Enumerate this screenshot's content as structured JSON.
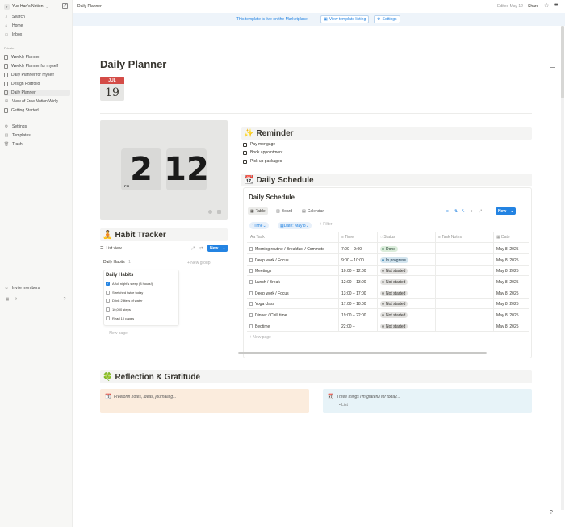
{
  "sidebar": {
    "workspace_initial": "Y",
    "workspace_name": "Yue Han's Notion",
    "top_items": [
      {
        "label": "Search",
        "icon": "search-icon"
      },
      {
        "label": "Home",
        "icon": "home-icon"
      },
      {
        "label": "Inbox",
        "icon": "inbox-icon"
      }
    ],
    "section_label": "Private",
    "pages": [
      {
        "label": "Weekly Planner",
        "active": false
      },
      {
        "label": "Weekly Planner for myself",
        "active": false
      },
      {
        "label": "Daily Planner for myself",
        "active": false
      },
      {
        "label": "Design Portfolio",
        "active": false
      },
      {
        "label": "Daily Planner",
        "active": true
      },
      {
        "label": "View of Free Notion Widg...",
        "active": false
      },
      {
        "label": "Getting Started",
        "active": false
      }
    ],
    "bottom_items": [
      {
        "label": "Settings",
        "icon": "gear-icon"
      },
      {
        "label": "Templates",
        "icon": "templates-icon"
      },
      {
        "label": "Trash",
        "icon": "trash-icon"
      }
    ],
    "invite_label": "Invite members"
  },
  "topbar": {
    "breadcrumb": "Daily Planner",
    "edited": "Edited May 12",
    "share": "Share"
  },
  "banner": {
    "text": "This template is live on the Marketplace",
    "view_listing": "View template listing",
    "settings": "Settings"
  },
  "page": {
    "title": "Daily Planner",
    "calendar_month": "JUL",
    "calendar_day": "19"
  },
  "clock": {
    "hour": "2",
    "minute": "12",
    "period": "PM"
  },
  "reminder": {
    "heading": "Reminder",
    "emoji": "✨",
    "todos": [
      "Pay mortgage",
      "Book appointment",
      "Pick up packages"
    ]
  },
  "schedule": {
    "heading": "Daily Schedule",
    "emoji": "📆",
    "db_title": "Daily Schedule",
    "views": [
      "Table",
      "Board",
      "Calendar"
    ],
    "new_label": "New",
    "chips": {
      "time": "Time",
      "date": "Date: May 8",
      "filter": "+ Filter"
    },
    "columns": [
      "Task",
      "Time",
      "Status",
      "Task Notes",
      "Date"
    ],
    "rows": [
      {
        "task": "Morning routine / Breakfast / Commute",
        "time": "7:00 – 9:00",
        "status": "Done",
        "date": "May 8, 2025"
      },
      {
        "task": "Deep work / Focus",
        "time": "9:00 – 10:00",
        "status": "In progress",
        "date": "May 8, 2025"
      },
      {
        "task": "Meetings",
        "time": "10:00 – 12:00",
        "status": "Not started",
        "date": "May 8, 2025"
      },
      {
        "task": "Lunch / Break",
        "time": "12:00 – 13:00",
        "status": "Not started",
        "date": "May 8, 2025"
      },
      {
        "task": "Deep work / Focus",
        "time": "13:00 – 17:00",
        "status": "Not started",
        "date": "May 8, 2025"
      },
      {
        "task": "Yoga class",
        "time": "17:00 – 18:00",
        "status": "Not started",
        "date": "May 8, 2025"
      },
      {
        "task": "Dinner / Chill time",
        "time": "19:00 – 22:00",
        "status": "Not started",
        "date": "May 8, 2025"
      },
      {
        "task": "Bedtime",
        "time": "22:00 –",
        "status": "Not started",
        "date": "May 8, 2025"
      }
    ],
    "new_page": "+ New page",
    "status_colors": {
      "Done": {
        "bg": "#dbeddb",
        "fg": "#1c3829",
        "dot": "#6c9b7d"
      },
      "In progress": {
        "bg": "#d3e5ef",
        "fg": "#183347",
        "dot": "#5b97bd"
      },
      "Not started": {
        "bg": "#e3e2e0",
        "fg": "#32302c",
        "dot": "#91918e"
      }
    }
  },
  "habit": {
    "heading": "Habit Tracker",
    "emoji": "🧘",
    "view_label": "List view",
    "new_label": "New",
    "group_label": "Daily Habits",
    "group_count": "1",
    "new_group": "+ New group",
    "card_title": "Daily Habits",
    "items": [
      {
        "label": "A full night's sleep (8 hours!)",
        "checked": true
      },
      {
        "label": "Stretched twice today",
        "checked": false
      },
      {
        "label": "Drink 2 liters of water",
        "checked": false
      },
      {
        "label": "10,000 steps",
        "checked": false
      },
      {
        "label": "Read 10 pages",
        "checked": false
      }
    ],
    "new_page": "+ New page"
  },
  "reflection": {
    "heading": "Reflection & Gratitude",
    "emoji": "🍀",
    "left_placeholder": "Freeform notes, ideas, journaling...",
    "right_placeholder": "Three things I'm grateful for today...",
    "list_label": "List",
    "left_color": "#fbecdd",
    "right_color": "#e7f3f8"
  }
}
